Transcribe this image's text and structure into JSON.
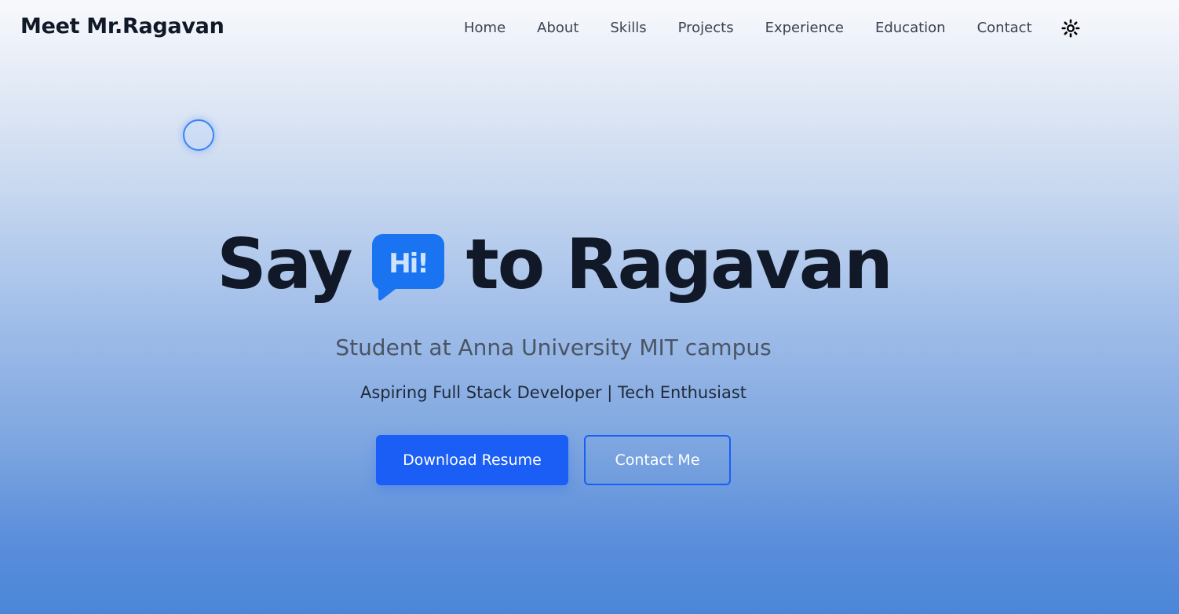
{
  "header": {
    "brand": "Meet Mr.Ragavan",
    "nav": [
      "Home",
      "About",
      "Skills",
      "Projects",
      "Experience",
      "Education",
      "Contact"
    ],
    "theme_icon": "sun-icon"
  },
  "hero": {
    "title_before": "Say",
    "bubble_text": "Hi!",
    "title_after": "to Ragavan",
    "subtitle": "Student at Anna University MIT campus",
    "tagline": "Aspiring Full Stack Developer | Tech Enthusiast",
    "primary_button": "Download Resume",
    "secondary_button": "Contact Me"
  },
  "colors": {
    "accent": "#1a5ef5",
    "text_dark": "#111827",
    "text_muted": "#4b5563"
  }
}
